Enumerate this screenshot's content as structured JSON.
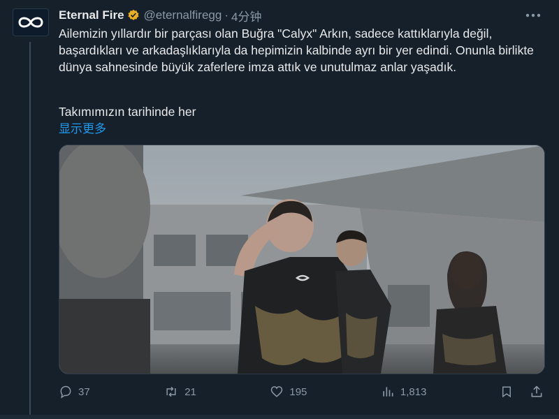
{
  "author": {
    "name": "Eternal Fire",
    "handle": "@eternalfiregg",
    "separator": "·",
    "time": "4分钟",
    "avatar_icon": "eternal-fire-logo",
    "verified_color": "#e8b020"
  },
  "tweet": {
    "text": "Ailemizin yıllardır bir parçası olan Buğra \"Calyx\" Arkın, sadece kattıklarıyla değil, başardıkları ve arkadaşlıklarıyla da hepimizin kalbinde ayrı bir yer edindi. Onunla birlikte dünya sahnesinde büyük zaferlere imza attık ve unutulmaz anlar yaşadık.",
    "paragraph2": "Takımımızın tarihinde her",
    "show_more": "显示更多"
  },
  "actions": {
    "replies": "37",
    "retweets": "21",
    "likes": "195",
    "views": "1,813"
  },
  "colors": {
    "background": "#16202b",
    "link": "#1d9bf0",
    "muted": "#8b98a5"
  }
}
